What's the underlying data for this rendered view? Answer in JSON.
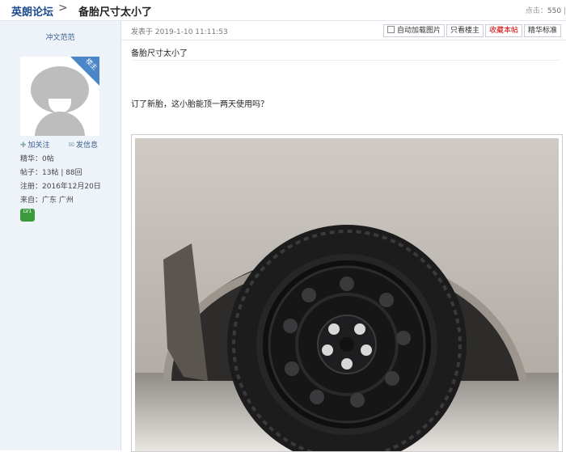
{
  "header": {
    "forum_name": "英朗论坛",
    "separator": ">",
    "thread_title": "备胎尺寸太小了",
    "stats_label": "点击：",
    "stats_value": "550",
    "stats_sep": "|"
  },
  "author": {
    "name": "冲文范范",
    "badge": "楼主",
    "follow_label": "加关注",
    "message_label": "发信息",
    "info": [
      "精华：0帖",
      "帖子：13帖 | 88回",
      "注册：2016年12月20日",
      "来自：广东 广州"
    ],
    "level_badge": "LV1"
  },
  "post": {
    "posted_at": "发表于 2019-1-10 11:11:53",
    "buttons": {
      "auto_load": "自动加载图片",
      "only_op": "只看楼主",
      "favorite": "收藏本帖",
      "best": "精华标准"
    },
    "subject": "备胎尺寸太小了",
    "content": "订了新胎，这小胎能顶一两天使用吗？"
  }
}
